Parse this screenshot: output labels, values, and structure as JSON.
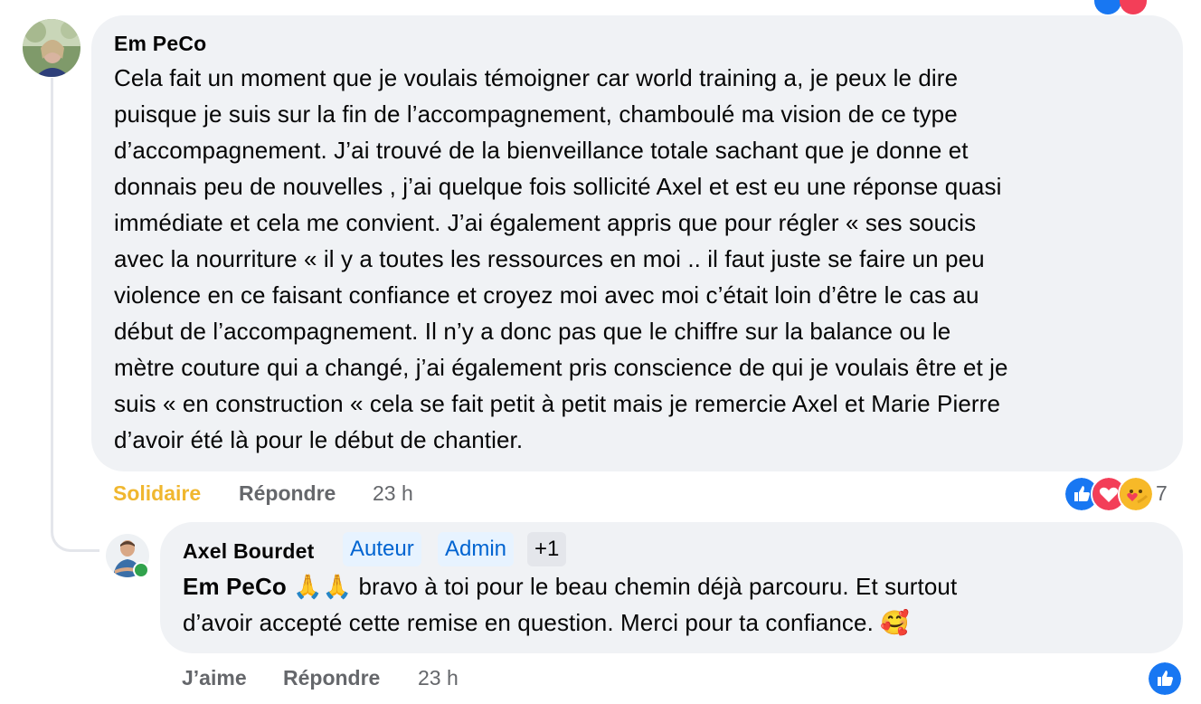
{
  "comment1": {
    "author": "Em PeCo",
    "lines": [
      "Cela fait un moment que je voulais témoigner car world training a, je peux le dire",
      "puisque je suis sur la fin de l’accompagnement, chamboulé ma vision de ce type",
      "d’accompagnement. J’ai trouvé de la bienveillance totale sachant que je donne et",
      "donnais peu de nouvelles , j’ai quelque fois sollicité Axel et est eu une réponse quasi",
      "immédiate et cela me convient. J’ai également appris que pour régler « ses soucis",
      "avec la nourriture « il y a toutes les ressources en moi .. il faut juste se faire un peu",
      "violence en ce faisant confiance et croyez moi avec moi c’était loin d’être le cas au",
      "début de l’accompagnement. Il n’y a donc pas que le chiffre sur la balance ou le",
      "mètre couture qui a changé, j’ai également pris conscience de qui je voulais être et je",
      "suis « en construction « cela se fait petit à petit mais je remercie Axel et Marie Pierre",
      "d’avoir été là pour le début de chantier."
    ],
    "actions": {
      "reaction_label": "Solidaire",
      "reply_label": "Répondre",
      "time": "23 h"
    },
    "reactions": {
      "icons": [
        "like-icon",
        "love-icon",
        "care-icon"
      ],
      "count": "7"
    },
    "colors": {
      "solidaire": "#f0b72f"
    }
  },
  "reply1": {
    "author": "Axel Bourdet",
    "badges": [
      "Auteur",
      "Admin"
    ],
    "badge_more": "+1",
    "mention": "Em PeCo",
    "emoji": "🙏🙏",
    "text_line1": " bravo à toi pour le beau chemin déjà parcouru. Et surtout",
    "text_line2": "d’avoir accepté cette remise en question. Merci pour ta confiance. ",
    "end_emoji": "🥰",
    "actions": {
      "like_label": "J’aime",
      "reply_label": "Répondre",
      "time": "23 h"
    },
    "reactions": {
      "icons": [
        "like-icon"
      ]
    },
    "status": "online"
  },
  "colors": {
    "bubble_bg": "#f0f2f5",
    "secondary_text": "#65676b",
    "like_blue": "#1877f2",
    "love_red": "#f33e58",
    "online_green": "#31a24c"
  }
}
